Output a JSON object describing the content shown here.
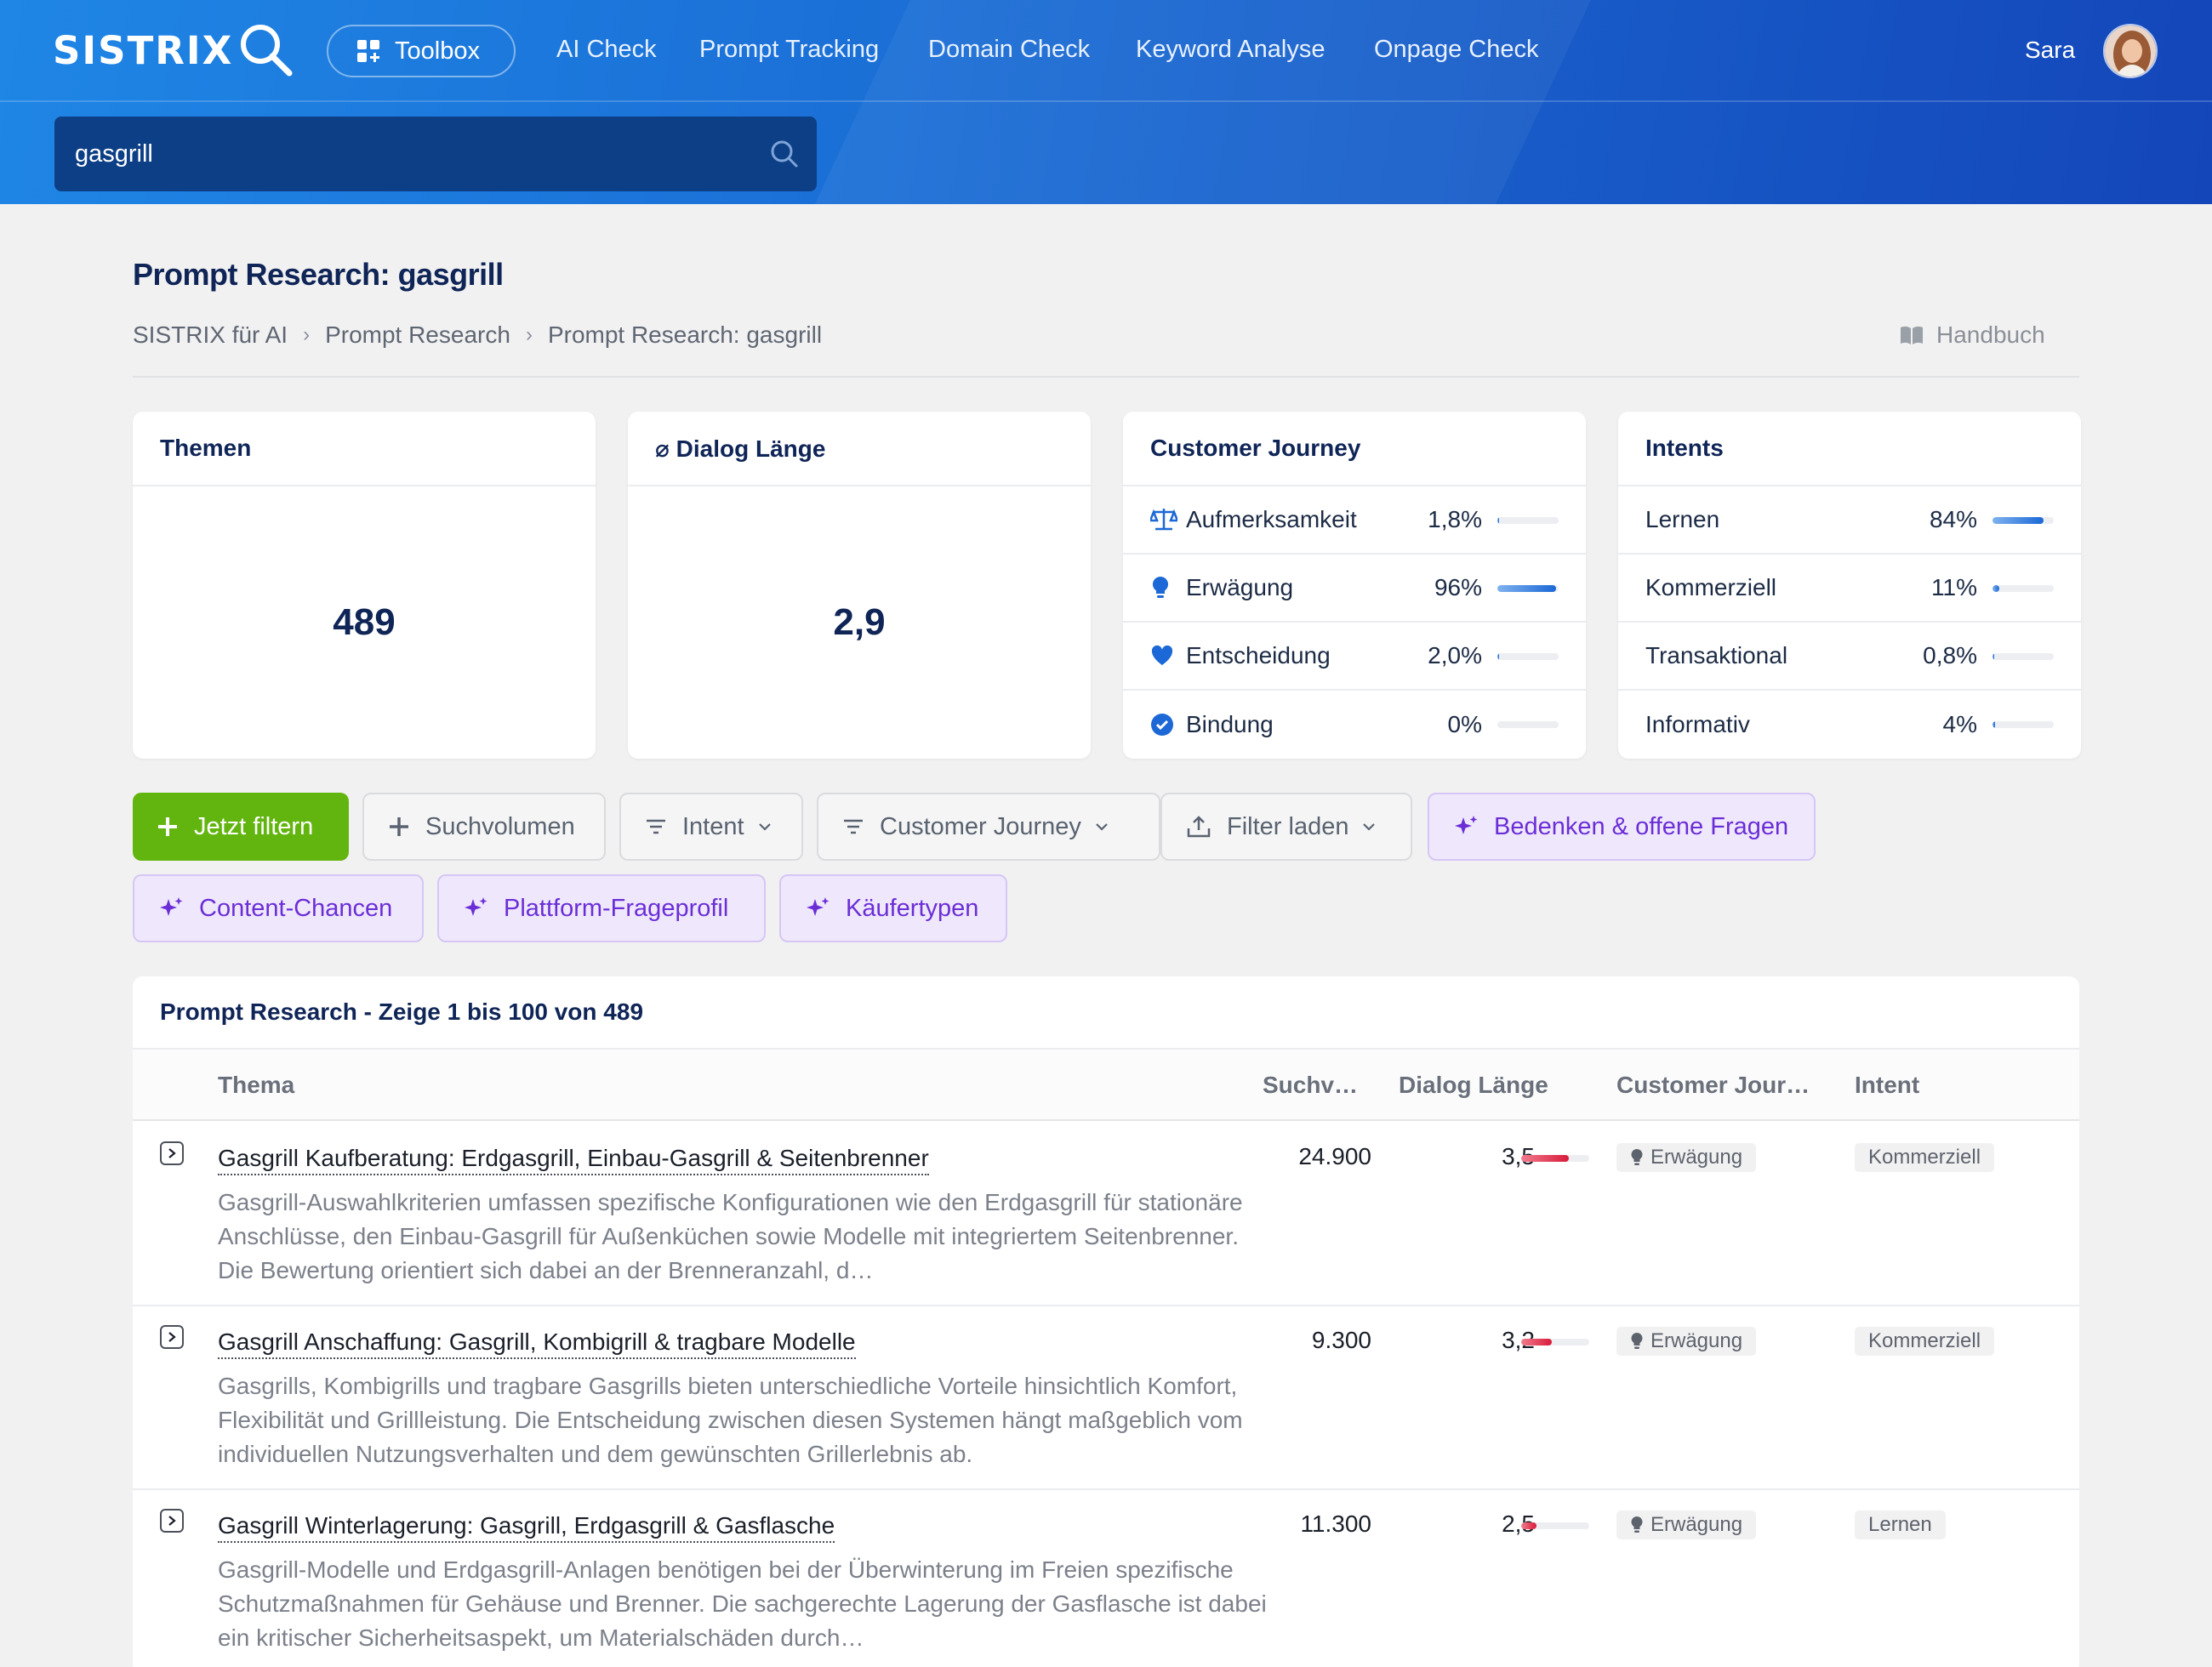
{
  "header": {
    "logo": "SISTRIX",
    "toolbox_label": "Toolbox",
    "nav": [
      "AI Check",
      "Prompt Tracking",
      "Domain Check",
      "Keyword Analyse",
      "Onpage Check"
    ],
    "user_name": "Sara",
    "search_value": "gasgrill"
  },
  "page": {
    "title": "Prompt Research: gasgrill",
    "breadcrumb": [
      "SISTRIX für AI",
      "Prompt Research",
      "Prompt Research: gasgrill"
    ],
    "manual_label": "Handbuch"
  },
  "cards": {
    "themen": {
      "title": "Themen",
      "value": "489"
    },
    "dialog": {
      "title": "⌀ Dialog Länge",
      "value": "2,9"
    },
    "journey": {
      "title": "Customer Journey",
      "rows": [
        {
          "label": "Aufmerksamkeit",
          "value": "1,8%",
          "fraction": 0.018,
          "icon": "scale-icon"
        },
        {
          "label": "Erwägung",
          "value": "96%",
          "fraction": 0.96,
          "icon": "lightbulb-icon"
        },
        {
          "label": "Entscheidung",
          "value": "2,0%",
          "fraction": 0.02,
          "icon": "heart-icon"
        },
        {
          "label": "Bindung",
          "value": "0%",
          "fraction": 0,
          "icon": "check-circle-icon"
        }
      ]
    },
    "intents": {
      "title": "Intents",
      "rows": [
        {
          "label": "Lernen",
          "value": "84%",
          "fraction": 0.84
        },
        {
          "label": "Kommerziell",
          "value": "11%",
          "fraction": 0.11
        },
        {
          "label": "Transaktional",
          "value": "0,8%",
          "fraction": 0.008
        },
        {
          "label": "Informativ",
          "value": "4%",
          "fraction": 0.04
        }
      ]
    }
  },
  "filters": {
    "apply": "Jetzt filtern",
    "volume": "Suchvolumen",
    "intent": "Intent",
    "journey": "Customer Journey",
    "load": "Filter laden",
    "ai1": "Bedenken & offene Fragen",
    "ai2": "Content-Chancen",
    "ai3": "Plattform-Frageprofil",
    "ai4": "Käufertypen"
  },
  "table": {
    "title": "Prompt Research - Zeige 1 bis 100 von 489",
    "columns": [
      "Thema",
      "Suchv…",
      "Dialog Länge",
      "Customer Jour…",
      "Intent"
    ],
    "rows": [
      {
        "title": "Gasgrill Kaufberatung: Erdgasgrill, Einbau-Gasgrill & Seitenbrenner",
        "desc": "Gasgrill-Auswahlkriterien umfassen spezifische Konfigurationen wie den Erdgasgrill für stationäre Anschlüsse, den Einbau-Gasgrill für Außenküchen sowie Modelle mit integriertem Seitenbrenner. Die Bewertung orientiert sich dabei an der Brenneranzahl, d…",
        "volume": "24.900",
        "dialog": "3,5",
        "dialog_fraction": 0.7,
        "journey": "Erwägung",
        "intent": "Kommerziell"
      },
      {
        "title": "Gasgrill Anschaffung: Gasgrill, Kombigrill & tragbare Modelle",
        "desc": "Gasgrills, Kombigrills und tragbare Gasgrills bieten unterschiedliche Vorteile hinsichtlich Komfort, Flexibilität und Grillleistung. Die Entscheidung zwischen diesen Systemen hängt maßgeblich vom individuellen Nutzungsverhalten und dem gewünschten Grillerlebnis ab.",
        "volume": "9.300",
        "dialog": "3,2",
        "dialog_fraction": 0.45,
        "journey": "Erwägung",
        "intent": "Kommerziell"
      },
      {
        "title": "Gasgrill Winterlagerung: Gasgrill, Erdgasgrill & Gasflasche",
        "desc": "Gasgrill-Modelle und Erdgasgrill-Anlagen benötigen bei der Überwinterung im Freien spezifische Schutzmaßnahmen für Gehäuse und Brenner. Die sachgerechte Lagerung der Gasflasche ist dabei ein kritischer Sicherheitsaspekt, um Materialschäden durch…",
        "volume": "11.300",
        "dialog": "2,5",
        "dialog_fraction": 0.22,
        "journey": "Erwägung",
        "intent": "Lernen"
      }
    ]
  }
}
